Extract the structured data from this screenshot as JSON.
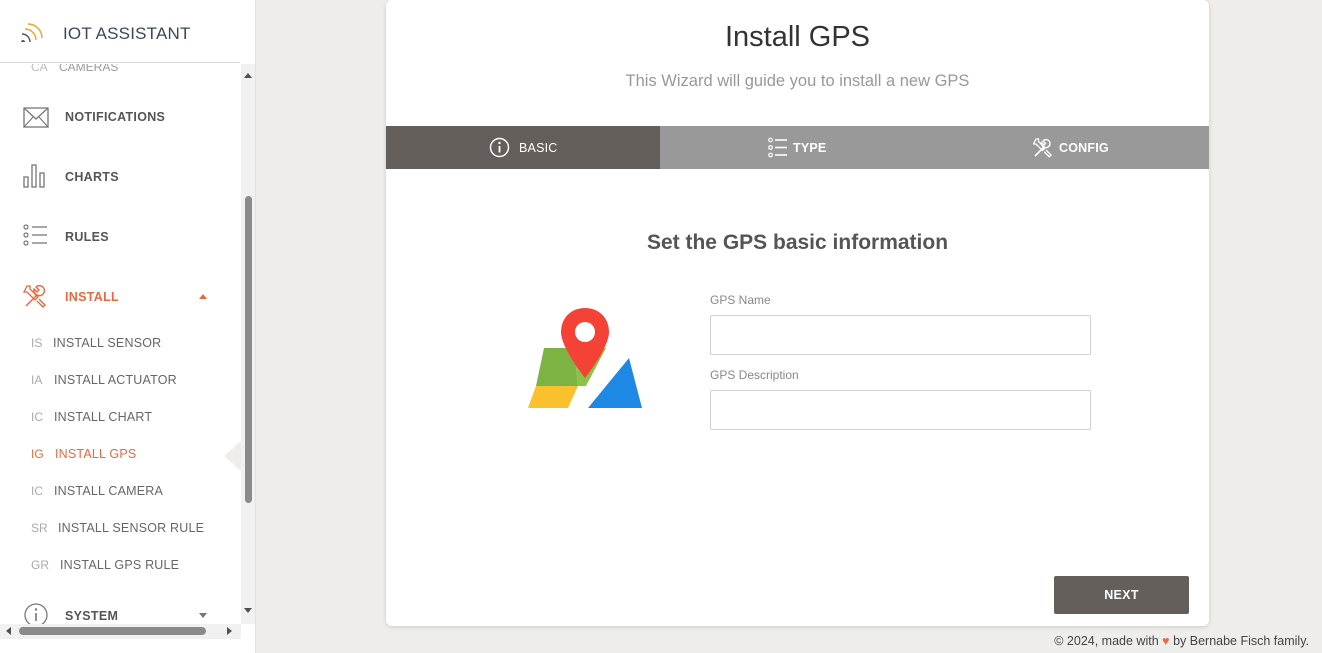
{
  "brand": {
    "title": "IOT ASSISTANT",
    "icon": "wifi-signal-icon"
  },
  "sidebar": {
    "partial_item": {
      "abbr": "CA",
      "label": "CAMERAS"
    },
    "items": [
      {
        "label": "NOTIFICATIONS",
        "icon": "envelope-icon"
      },
      {
        "label": "CHARTS",
        "icon": "bar-chart-icon"
      },
      {
        "label": "RULES",
        "icon": "list-icon"
      },
      {
        "label": "INSTALL",
        "icon": "tools-icon",
        "expanded": true,
        "active": true
      },
      {
        "label": "SYSTEM",
        "icon": "info-icon",
        "expanded": false
      }
    ],
    "install_subitems": [
      {
        "abbr": "IS",
        "label": "INSTALL SENSOR"
      },
      {
        "abbr": "IA",
        "label": "INSTALL ACTUATOR"
      },
      {
        "abbr": "IC",
        "label": "INSTALL CHART"
      },
      {
        "abbr": "IG",
        "label": "INSTALL GPS",
        "active": true
      },
      {
        "abbr": "IC",
        "label": "INSTALL CAMERA"
      },
      {
        "abbr": "SR",
        "label": "INSTALL SENSOR RULE"
      },
      {
        "abbr": "GR",
        "label": "INSTALL GPS RULE"
      }
    ]
  },
  "wizard": {
    "title": "Install GPS",
    "subtitle": "This Wizard will guide you to install a new GPS",
    "tabs": [
      {
        "label": "BASIC",
        "icon": "info-circle-icon",
        "active": true
      },
      {
        "label": "TYPE",
        "icon": "list-icon"
      },
      {
        "label": "CONFIG",
        "icon": "tools-icon"
      }
    ],
    "section_title": "Set the GPS basic information",
    "fields": {
      "name_label": "GPS Name",
      "name_value": "",
      "description_label": "GPS Description",
      "description_value": ""
    },
    "next_label": "NEXT"
  },
  "footer": {
    "prefix": "© 2024, made with",
    "heart": "♥",
    "suffix": "by Bernabe Fisch family."
  },
  "colors": {
    "accent": "#e8683f",
    "active_tab": "#645f5a",
    "tab_bar": "#999999",
    "background": "#eeedeb"
  }
}
